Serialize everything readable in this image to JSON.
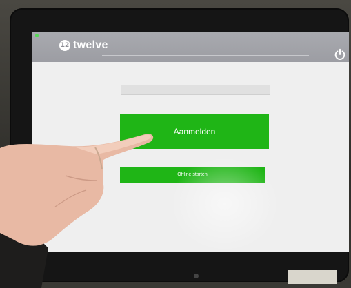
{
  "app": {
    "logo_glyph": "12",
    "logo_text": "twelve"
  },
  "header": {
    "power_icon": "power-icon"
  },
  "login": {
    "input_value": "",
    "login_label": "Aanmelden",
    "offline_label": "Offline starten"
  },
  "colors": {
    "topbar": "#a0a1a7",
    "button_green": "#1fb516",
    "screen_bg": "#efefef",
    "bezel": "#151515"
  }
}
